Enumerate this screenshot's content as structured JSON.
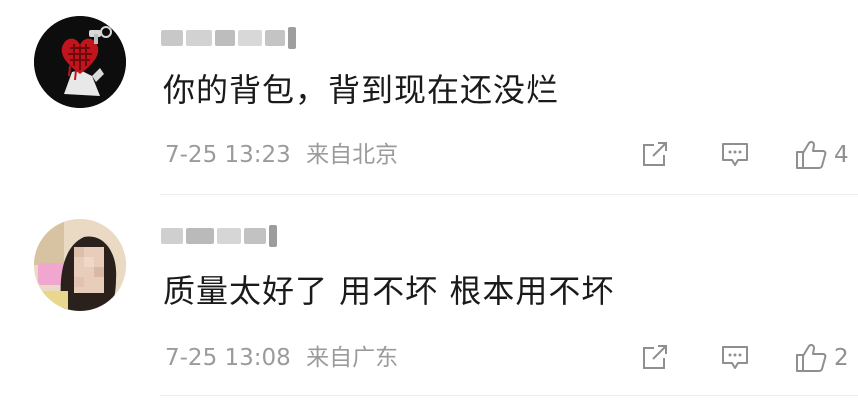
{
  "comments": [
    {
      "avatar": "red-grenade-heart-on-black",
      "username_blur": [
        "#c8c8c8",
        "#d2d2d2",
        "#bdbdbd",
        "#d8d8d8",
        "#c4c4c4",
        "#9e9e9e"
      ],
      "text": "你的背包，背到现在还没烂",
      "time": "7-25 13:23",
      "location": "来自北京",
      "likes": "4"
    },
    {
      "avatar": "woman-portrait-blurred",
      "username_blur": [
        "#cfcfcf",
        "#bababa",
        "#d6d6d6",
        "#c2c2c2",
        "#9c9c9c"
      ],
      "text": "质量太好了 用不坏 根本用不坏",
      "time": "7-25 13:08",
      "location": "来自广东",
      "likes": "2"
    }
  ],
  "icons": {
    "share": "share-icon",
    "comment": "comment-icon",
    "like": "thumbs-up-icon"
  },
  "colors": {
    "text": "#1a1a1a",
    "meta": "#9b9b9b",
    "icon": "#8f8f8f",
    "divider": "#ececec"
  }
}
